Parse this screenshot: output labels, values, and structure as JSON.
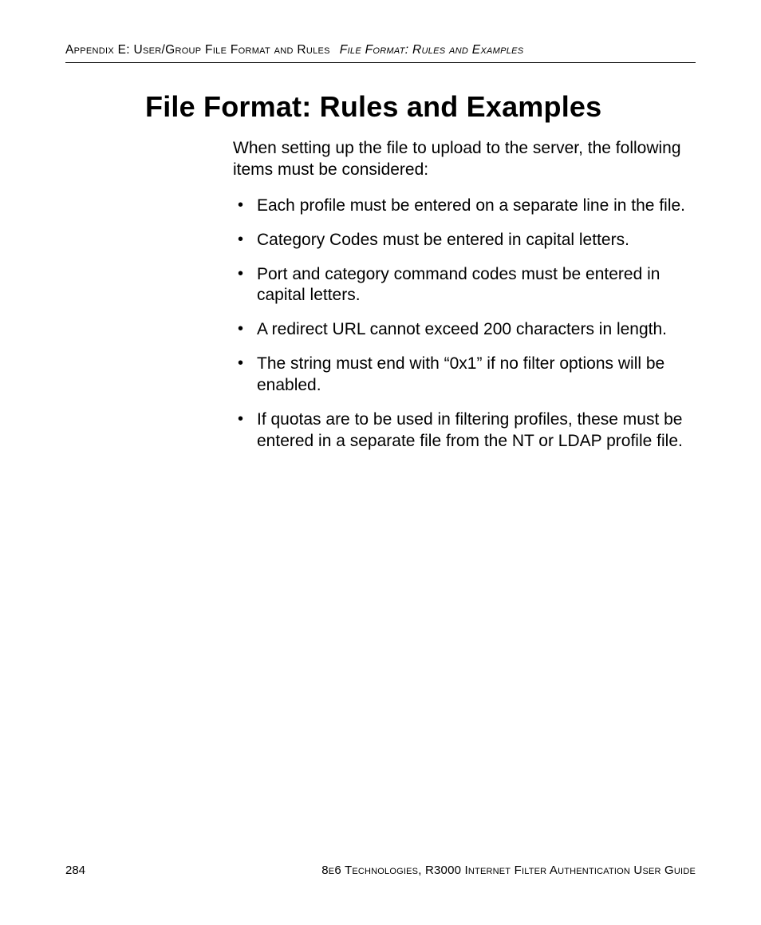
{
  "header": {
    "left": "Appendix E: User/Group File Format and Rules",
    "right": "File Format: Rules and Examples"
  },
  "title": "File Format: Rules and Examples",
  "intro": "When setting up the file to upload to the server, the following items must be considered:",
  "bullets": [
    "Each profile must be entered on a separate line in the file.",
    "Category Codes must be entered in capital letters.",
    "Port and category command codes must be entered in capital letters.",
    "A redirect URL cannot exceed 200 characters in length.",
    "The string must end with “0x1” if no filter options will be enabled.",
    "If quotas are to be used in filtering profiles, these must be entered in a separate file from the NT or LDAP profile file."
  ],
  "footer": {
    "page_number": "284",
    "right": "8e6 Technologies, R3000 Internet Filter Authentication User Guide"
  }
}
